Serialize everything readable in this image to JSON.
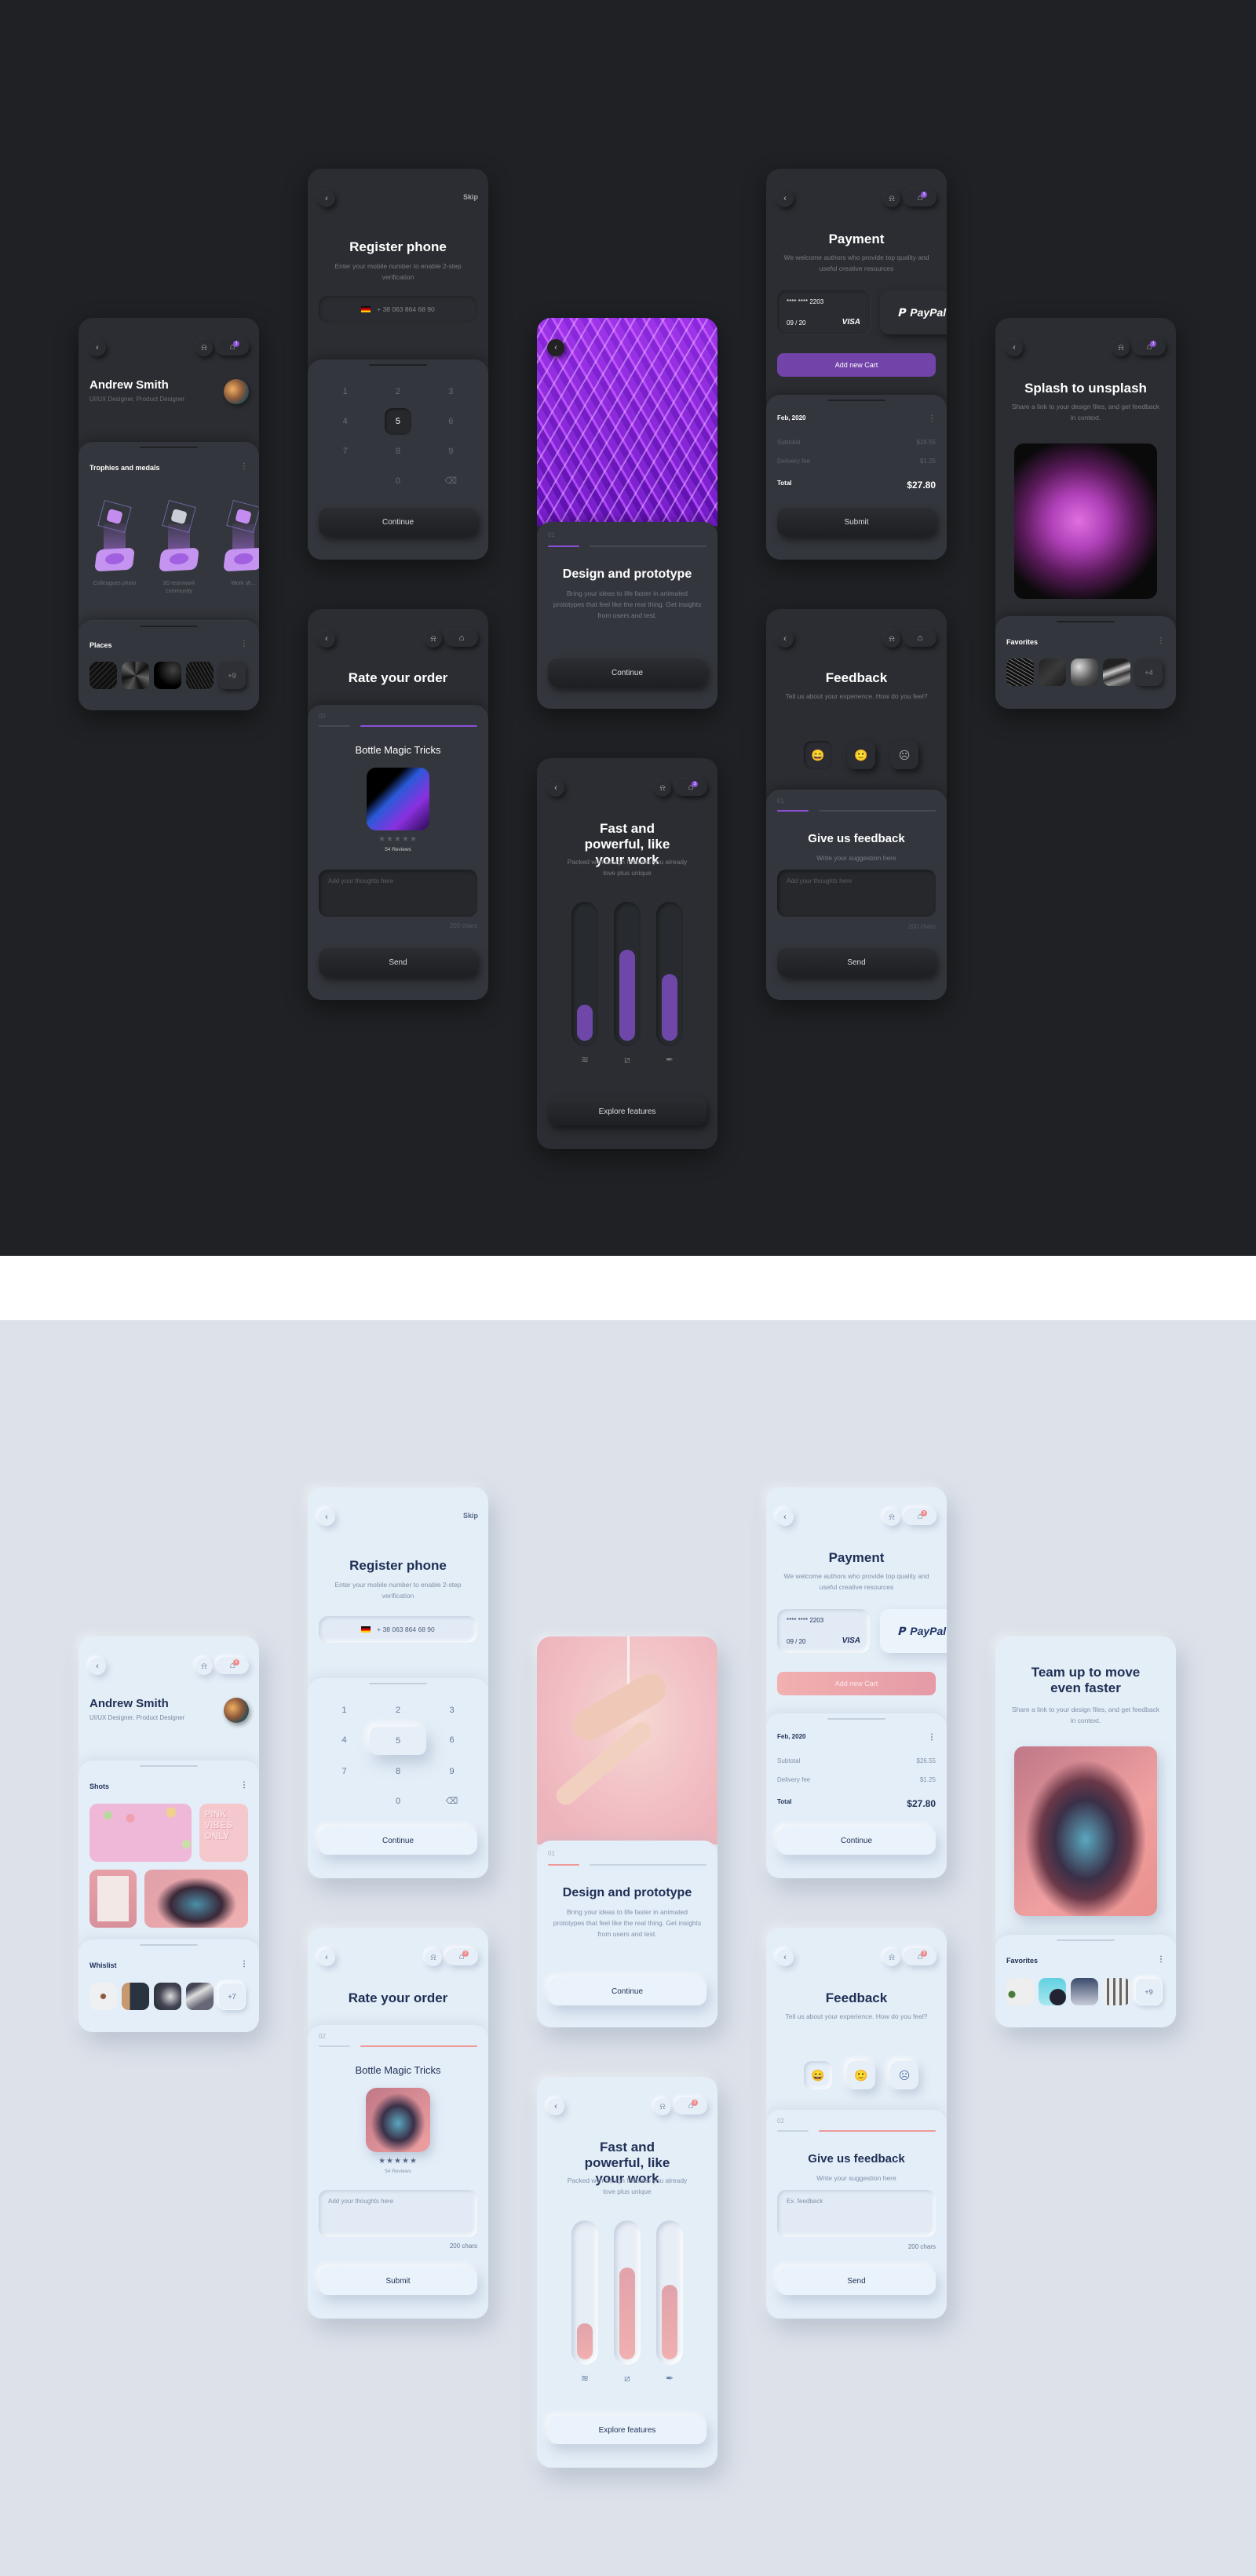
{
  "themes": {
    "dark": {
      "accent": "#7243a8",
      "background": "#1f2124",
      "card": "#2b2d32"
    },
    "light": {
      "accent": "#ef9a9a",
      "background": "#dde2ea",
      "card": "#e4eef7"
    }
  },
  "common": {
    "back_icon": "‹",
    "bell_icon": "🔔",
    "cart_icon": "🧺",
    "cart_badge": "3",
    "more_icon": "⋮"
  },
  "dark": {
    "profile": {
      "name": "Andrew Smith",
      "role": "UI/UX Designer, Product Designer",
      "trophies_title": "Trophies and medals",
      "trophies": [
        {
          "label": "Colleagues photo"
        },
        {
          "label": "3D teamwork community"
        },
        {
          "label": "Work sh..."
        }
      ],
      "places_title": "Places",
      "places_more": "+9"
    },
    "register": {
      "skip": "Skip",
      "title": "Register phone",
      "subtitle": "Enter your mobile number to enable 2-step verification",
      "phone": "+ 38 063 864 68 90",
      "keys": [
        "1",
        "2",
        "3",
        "4",
        "5",
        "6",
        "7",
        "8",
        "9",
        "",
        "0",
        "⌫"
      ],
      "active_key": "5",
      "continue": "Continue"
    },
    "design": {
      "step": "01",
      "progress": 0.2,
      "title": "Design and prototype",
      "subtitle": "Bring your ideas to life faster in animated prototypes that feel like the real thing. Get insights from users and test.",
      "continue": "Continue"
    },
    "payment": {
      "title": "Payment",
      "subtitle": "We welcome authors who provide top quality and useful creative resources",
      "card_number": "**** **** 2203",
      "card_expiry": "09 / 20",
      "card_brand": "VISA",
      "paypal": "PayPal",
      "add_card": "Add new Cart",
      "period": "Feb, 2020",
      "subtotal_label": "Subtotal",
      "subtotal": "$26.55",
      "delivery_label": "Delivery fee",
      "delivery": "$1.25",
      "total_label": "Total",
      "total": "$27.80",
      "submit": "Submit"
    },
    "splash": {
      "title": "Splash to unsplash",
      "subtitle": "Share a link to your design files, and get feedback in context.",
      "favorites_title": "Favorites",
      "favorites_more": "+4"
    },
    "rate": {
      "title": "Rate your order",
      "step": "02",
      "progress": 0.2,
      "product": "Bottle Magic Tricks",
      "stars": "★★★★★",
      "reviews": "54 Reviews",
      "placeholder": "Add your thoughts here",
      "chars": "200 chars",
      "send": "Send"
    },
    "fast": {
      "title": "Fast and powerful, like your work",
      "subtitle": "Packed with design features you already love plus unique",
      "levels": [
        0.27,
        0.68,
        0.5
      ],
      "icons": [
        "layers-icon",
        "crop-icon",
        "pen-icon"
      ],
      "explore": "Explore features"
    },
    "feedback": {
      "title": "Feedback",
      "subtitle": "Tell us about your experience. How do you feel?",
      "emojis": [
        "😄",
        "🙂",
        "☹"
      ],
      "selected": 0,
      "step": "01",
      "form_title": "Give us feedback",
      "form_subtitle": "Write your suggestion here",
      "placeholder": "Add your thoughts here",
      "chars": "200 chars",
      "send": "Send"
    }
  },
  "light": {
    "profile": {
      "name": "Andrew Smith",
      "role": "UI/UX Designer, Product Designer",
      "shots_title": "Shots",
      "wishlist_title": "Whislist",
      "wishlist_more": "+7"
    },
    "register": {
      "skip": "Skip",
      "title": "Register phone",
      "subtitle": "Enter your mobile number to enable 2-step verification",
      "phone": "+ 38 063 864 68 90",
      "keys": [
        "1",
        "2",
        "3",
        "4",
        "5",
        "6",
        "7",
        "8",
        "9",
        "",
        "0",
        "⌫"
      ],
      "active_key": "5",
      "continue": "Continue"
    },
    "design": {
      "step": "01",
      "progress": 0.2,
      "title": "Design and prototype",
      "subtitle": "Bring your ideas to life faster in animated prototypes that feel like the real thing. Get insights from users and test.",
      "continue": "Continue"
    },
    "payment": {
      "title": "Payment",
      "subtitle": "We welcome authors who provide top quality and useful creative resources",
      "card_number": "**** **** 2203",
      "card_expiry": "09 / 20",
      "card_brand": "VISA",
      "paypal": "PayPal",
      "add_card": "Add new Cart",
      "period": "Feb, 2020",
      "subtotal_label": "Subtotal",
      "subtotal": "$26.55",
      "delivery_label": "Delivery fee",
      "delivery": "$1.25",
      "total_label": "Total",
      "total": "$27.80",
      "submit": "Continue"
    },
    "team": {
      "title": "Team up to move even faster",
      "subtitle": "Share a link to your design files, and get feedback in context.",
      "favorites_title": "Favorites",
      "favorites_more": "+9"
    },
    "rate": {
      "title": "Rate your order",
      "step": "02",
      "progress": 0.2,
      "product": "Bottle Magic Tricks",
      "stars": "★★★★★",
      "reviews": "54 Reviews",
      "placeholder": "Add your thoughts here",
      "chars": "200 chars",
      "send": "Submit"
    },
    "fast": {
      "title": "Fast and powerful, like your work",
      "subtitle": "Packed with design features you already love plus unique",
      "levels": [
        0.27,
        0.69,
        0.56
      ],
      "icons": [
        "layers-icon",
        "crop-icon",
        "pen-icon"
      ],
      "explore": "Explore features"
    },
    "feedback": {
      "title": "Feedback",
      "subtitle": "Tell us about your experience. How do you feel?",
      "emojis": [
        "😄",
        "🙂",
        "☹"
      ],
      "selected": 0,
      "step": "02",
      "form_title": "Give us feedback",
      "form_subtitle": "Write your suggestion here",
      "placeholder": "Ex. feedback",
      "chars": "200 chars",
      "send": "Send"
    }
  }
}
